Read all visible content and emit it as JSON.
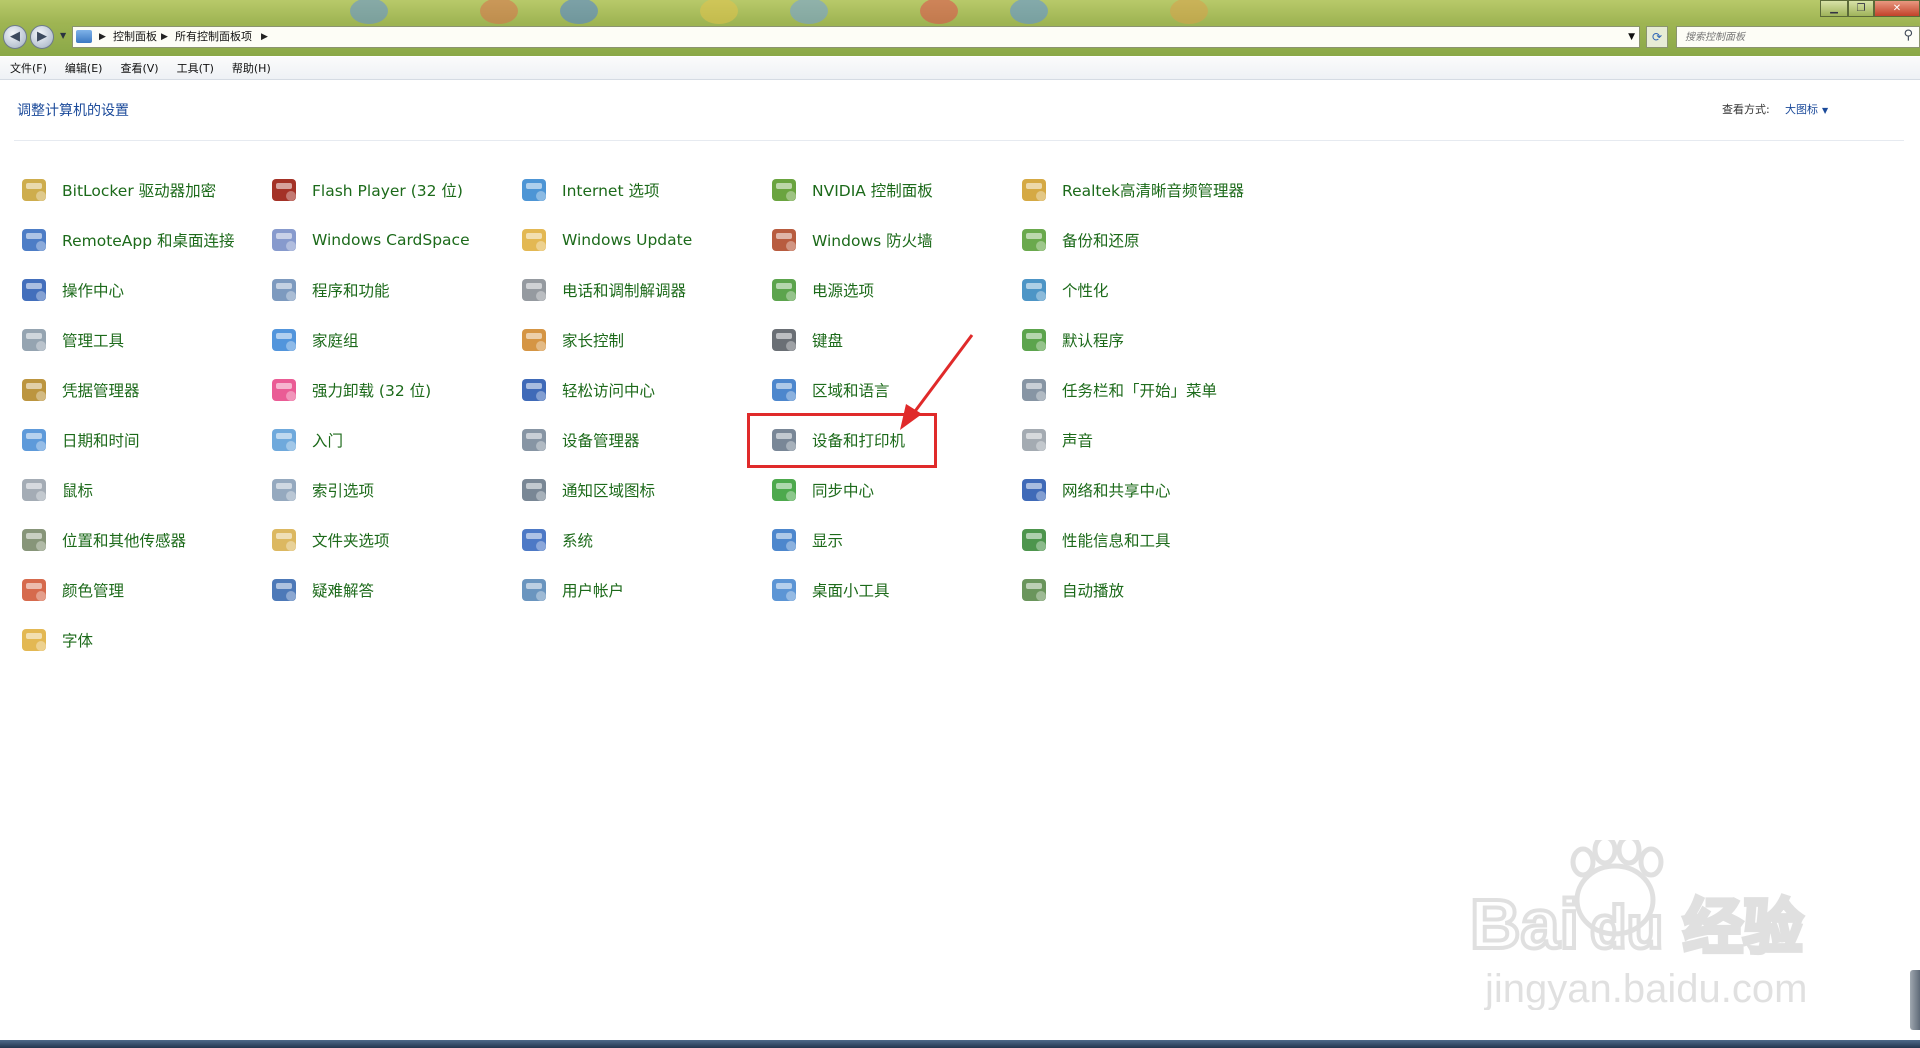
{
  "address_bar": {
    "crumbs": [
      "控制面板",
      "所有控制面板项"
    ]
  },
  "search": {
    "placeholder": "搜索控制面板"
  },
  "menu": [
    "文件(F)",
    "编辑(E)",
    "查看(V)",
    "工具(T)",
    "帮助(H)"
  ],
  "header": {
    "title": "调整计算机的设置",
    "view_label": "查看方式:",
    "view_value": "大图标"
  },
  "items": [
    [
      "BitLocker 驱动器加密",
      "RemoteApp 和桌面连接",
      "操作中心",
      "管理工具",
      "凭据管理器",
      "日期和时间",
      "鼠标",
      "位置和其他传感器",
      "颜色管理",
      "字体"
    ],
    [
      "Flash Player (32 位)",
      "Windows CardSpace",
      "程序和功能",
      "家庭组",
      "强力卸载 (32 位)",
      "入门",
      "索引选项",
      "文件夹选项",
      "疑难解答"
    ],
    [
      "Internet 选项",
      "Windows Update",
      "电话和调制解调器",
      "家长控制",
      "轻松访问中心",
      "设备管理器",
      "通知区域图标",
      "系统",
      "用户帐户"
    ],
    [
      "NVIDIA 控制面板",
      "Windows 防火墙",
      "电源选项",
      "键盘",
      "区域和语言",
      "设备和打印机",
      "同步中心",
      "显示",
      "桌面小工具"
    ],
    [
      "Realtek高清晰音频管理器",
      "备份和还原",
      "个性化",
      "默认程序",
      "任务栏和「开始」菜单",
      "声音",
      "网络和共享中心",
      "性能信息和工具",
      "自动播放"
    ]
  ],
  "icons": [
    [
      "bitlocker-icon",
      "remoteapp-icon",
      "action-center-flag-icon",
      "admin-tools-icon",
      "credential-vault-icon",
      "calendar-clock-icon",
      "mouse-icon",
      "sensor-icon",
      "color-management-icon",
      "fonts-folder-icon"
    ],
    [
      "flash-icon",
      "cardspace-icon",
      "programs-icon",
      "homegroup-icon",
      "uninstaller-clover-icon",
      "getting-started-icon",
      "indexing-magnifier-icon",
      "folder-options-icon",
      "troubleshooting-icon"
    ],
    [
      "internet-globe-icon",
      "windows-update-icon",
      "phone-modem-icon",
      "parental-controls-icon",
      "ease-of-access-icon",
      "device-manager-icon",
      "notification-area-icon",
      "system-computer-icon",
      "user-accounts-icon"
    ],
    [
      "nvidia-icon",
      "firewall-icon",
      "power-options-icon",
      "keyboard-icon",
      "region-language-icon",
      "devices-printers-icon",
      "sync-center-icon",
      "display-icon",
      "desktop-gadgets-icon"
    ],
    [
      "realtek-audio-icon",
      "backup-restore-icon",
      "personalization-icon",
      "default-programs-icon",
      "taskbar-start-menu-icon",
      "sound-speaker-icon",
      "network-sharing-icon",
      "performance-icon",
      "autoplay-icon"
    ]
  ],
  "icon_colors": [
    [
      "#c9a43a",
      "#3a6fc0",
      "#2f5fb5",
      "#8a9aa8",
      "#b58a2a",
      "#4c8fd6",
      "#9aa3ad",
      "#7a8a6a",
      "#d25a3a",
      "#e0b040"
    ],
    [
      "#9a1c10",
      "#7a8fc8",
      "#6f8fb8",
      "#3f8ad8",
      "#e84a8a",
      "#5fa0d8",
      "#8aa0b8",
      "#d8b050",
      "#3a6ab0"
    ],
    [
      "#3a8ad0",
      "#e0b040",
      "#8a8f96",
      "#d08a30",
      "#2a5ab0",
      "#7a8a9a",
      "#6a7a8a",
      "#3a6ac0",
      "#5a8ab8"
    ],
    [
      "#5a9a2a",
      "#b04a2a",
      "#4a9a3a",
      "#5a5f66",
      "#3a7ac8",
      "#6a7a8c",
      "#3aa03a",
      "#3a7ac8",
      "#4a8ad0"
    ],
    [
      "#d0a030",
      "#5aa03a",
      "#3a8ac0",
      "#4a9a3a",
      "#7a8a9a",
      "#9aa2aa",
      "#2a5ab0",
      "#3a8a3a",
      "#5a8a4a"
    ]
  ],
  "highlighted_item": "设备和打印机",
  "watermark": {
    "brand": "Baidu经验",
    "url": "jingyan.baidu.com"
  }
}
